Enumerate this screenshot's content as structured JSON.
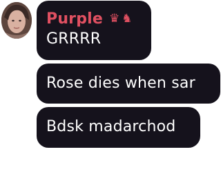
{
  "messages": [
    {
      "author": "Purple",
      "badges": [
        {
          "icon": "crown-icon",
          "glyph": "♛"
        },
        {
          "icon": "knight-icon",
          "glyph": "♞"
        }
      ],
      "text": "GRRRR"
    },
    {
      "text": "Rose dies when sar"
    },
    {
      "text": "Bdsk madarchod"
    }
  ],
  "colors": {
    "bubble_background": "#15121c",
    "author_name": "#e05061",
    "message_text": "#ffffff",
    "page_background": "#ffffff"
  }
}
